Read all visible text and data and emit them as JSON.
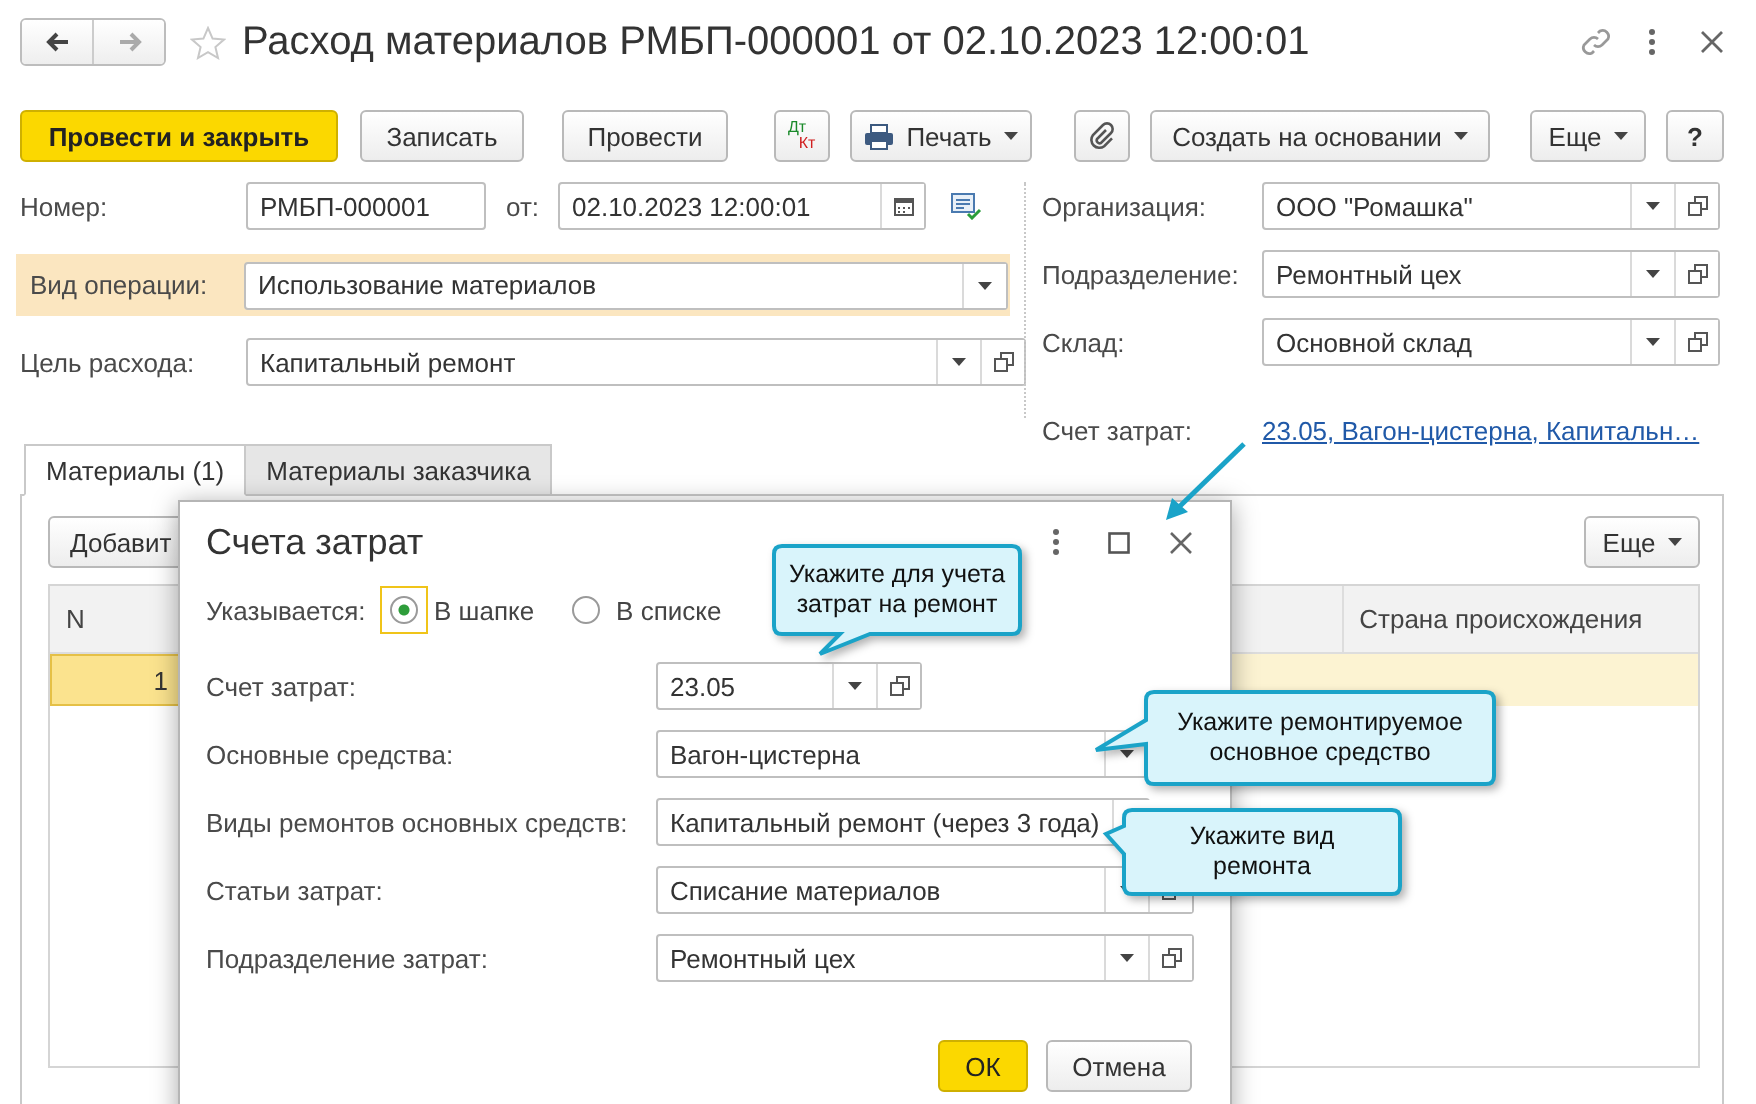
{
  "window": {
    "title": "Расход материалов РМБП-000001 от 02.10.2023 12:00:01"
  },
  "toolbar": [
    {
      "kind": "primary",
      "label": "Провести и закрыть"
    },
    {
      "kind": "plain",
      "label": "Записать"
    },
    {
      "kind": "plain",
      "label": "Провести"
    },
    {
      "kind": "dtkt",
      "label": "Дт",
      "label2": "Кт"
    },
    {
      "kind": "print",
      "label": "Печать"
    },
    {
      "kind": "attach"
    },
    {
      "kind": "menu",
      "label": "Создать на основании"
    },
    {
      "kind": "menu",
      "label": "Еще"
    },
    {
      "kind": "plain",
      "label": "?"
    }
  ],
  "header": {
    "number": {
      "label": "Номер:",
      "value": "РМБП-000001"
    },
    "date": {
      "label": "от:",
      "value": "02.10.2023 12:00:01"
    },
    "operation": {
      "label": "Вид операции:",
      "value": "Использование материалов",
      "focused": true
    },
    "purpose": {
      "label": "Цель расхода:",
      "value": "Капитальный ремонт"
    },
    "right": [
      {
        "label": "Организация:",
        "value": "ООО \"Ромашка\""
      },
      {
        "label": "Подразделение:",
        "value": "Ремонтный цех"
      },
      {
        "label": "Склад:",
        "value": "Основной склад"
      }
    ],
    "cost_account": {
      "label": "Счет затрат:",
      "link": "23.05, Вагон-цистерна, Капитальн…"
    }
  },
  "tabs": [
    {
      "label": "Материалы (1)",
      "selected": true
    },
    {
      "label": "Материалы заказчика",
      "selected": false
    }
  ],
  "table": {
    "add_button": "Добавит",
    "more_button": "Еще",
    "columns": [
      "N",
      "Страна происхождения"
    ],
    "rows": [
      {
        "n": "1",
        "selected": true
      }
    ]
  },
  "dialog": {
    "title": "Счета затрат",
    "specified": {
      "label": "Указывается:",
      "options": [
        {
          "label": "В шапке",
          "selected": true
        },
        {
          "label": "В списке",
          "selected": false
        }
      ]
    },
    "fields": [
      {
        "kind": "select-open",
        "label": "Счет затрат:",
        "value": "23.05"
      },
      {
        "kind": "select",
        "label": "Основные средства:",
        "value": "Вагон-цистерна"
      },
      {
        "kind": "select",
        "label": "Виды ремонтов основных средств:",
        "value": "Капитальный ремонт (через 3 года)"
      },
      {
        "kind": "select-open",
        "label": "Статьи затрат:",
        "value": "Списание материалов"
      },
      {
        "kind": "select-open",
        "label": "Подразделение затрат:",
        "value": "Ремонтный цех"
      }
    ],
    "buttons": [
      {
        "kind": "default",
        "label": "ОК"
      },
      {
        "kind": "plain",
        "label": "Отмена"
      }
    ]
  },
  "callouts": [
    {
      "text": "Укажите для учета затрат на ремонт"
    },
    {
      "text": "Укажите ремонтируемое основное средство"
    },
    {
      "text": "Укажите вид ремонта"
    }
  ]
}
